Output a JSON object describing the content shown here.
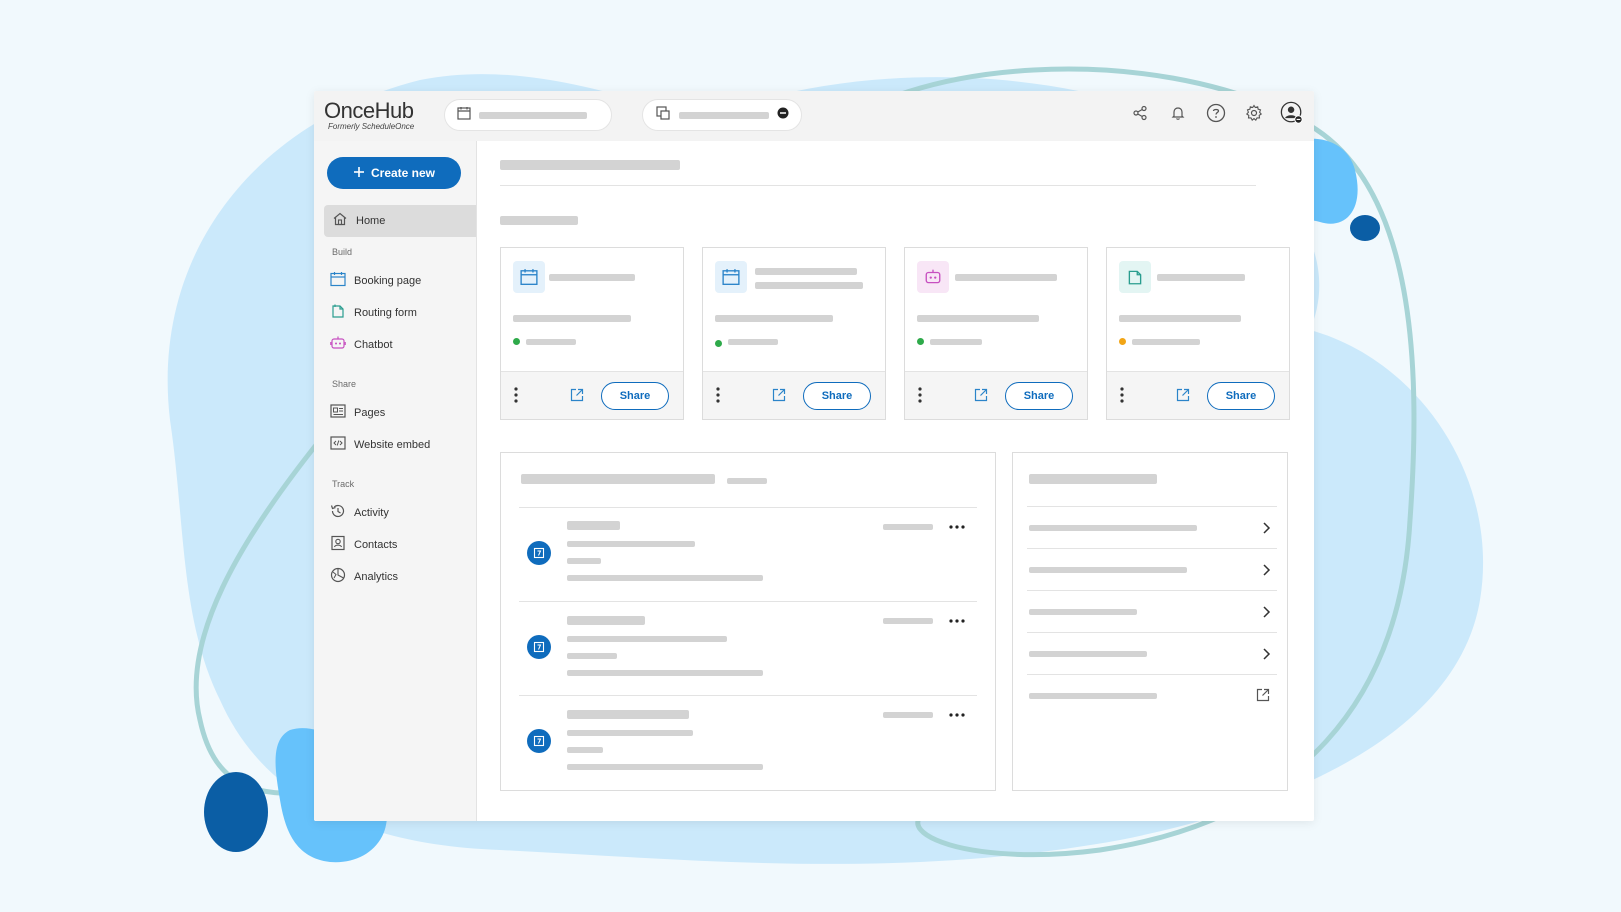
{
  "brand": {
    "logo": "OnceHub",
    "tagline": "Formerly ScheduleOnce"
  },
  "sidebar": {
    "create_label": "Create new",
    "home_label": "Home",
    "sections": {
      "build": "Build",
      "share": "Share",
      "track": "Track"
    },
    "items": {
      "booking_page": "Booking page",
      "routing_form": "Routing form",
      "chatbot": "Chatbot",
      "pages": "Pages",
      "website_embed": "Website embed",
      "activity": "Activity",
      "contacts": "Contacts",
      "analytics": "Analytics"
    }
  },
  "cards": [
    {
      "share_label": "Share",
      "status_color": "#2eaa4a",
      "icon": "calendar-icon",
      "icon_bg": "#e4f1fb",
      "icon_color": "#2b84c9"
    },
    {
      "share_label": "Share",
      "status_color": "#2eaa4a",
      "icon": "calendar-icon",
      "icon_bg": "#e4f1fb",
      "icon_color": "#2b84c9"
    },
    {
      "share_label": "Share",
      "status_color": "#2eaa4a",
      "icon": "chatbot-icon",
      "icon_bg": "#f8e6f6",
      "icon_color": "#c74fc0"
    },
    {
      "share_label": "Share",
      "status_color": "#f2a516",
      "icon": "routing-form-icon",
      "icon_bg": "#e3f5f3",
      "icon_color": "#2a9d8f"
    }
  ],
  "colors": {
    "accent": "#0f6cbd",
    "placeholder": "#d3d3d3"
  }
}
